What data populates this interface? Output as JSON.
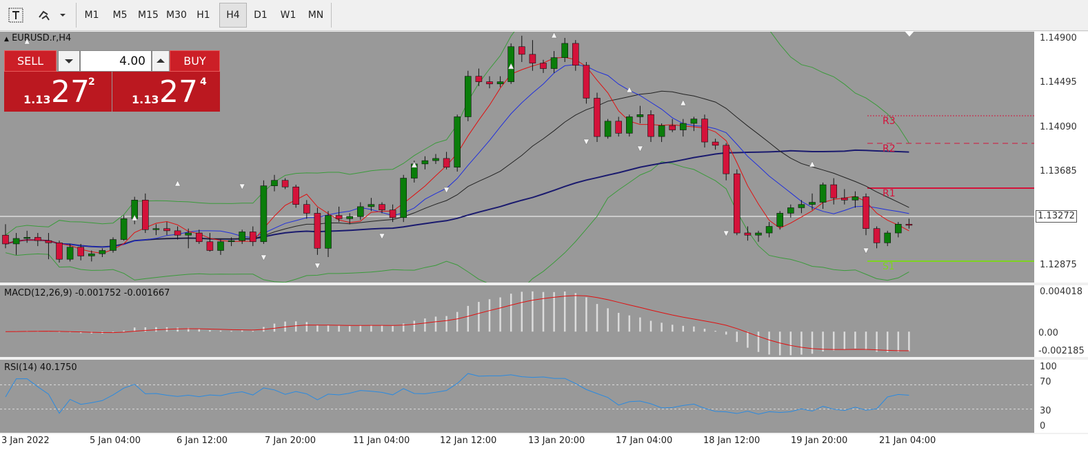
{
  "toolbar": {
    "periods": [
      {
        "label": "M1",
        "active": false
      },
      {
        "label": "M5",
        "active": false
      },
      {
        "label": "M15",
        "active": false
      },
      {
        "label": "M30",
        "active": false
      },
      {
        "label": "H1",
        "active": false
      },
      {
        "label": "H4",
        "active": true
      },
      {
        "label": "D1",
        "active": false
      },
      {
        "label": "W1",
        "active": false
      },
      {
        "label": "MN",
        "active": false
      }
    ]
  },
  "chart": {
    "symbol_label": "EURUSD.r,H4",
    "price_axis": [
      "1.14900",
      "1.14495",
      "1.14090",
      "1.13685",
      "1.13272",
      "1.12875"
    ],
    "current_price": "1.13272",
    "pivots": {
      "r3": "R3",
      "r2": "R2",
      "r1": "R1",
      "s1": "S1"
    },
    "colors": {
      "bull": "#0a7d0a",
      "bear": "#d4123a",
      "bg": "#999999"
    }
  },
  "trade_panel": {
    "sell_label": "SELL",
    "buy_label": "BUY",
    "lot": "4.00",
    "sell_price": {
      "small": "1.13",
      "big": "27",
      "sup": "2"
    },
    "buy_price": {
      "small": "1.13",
      "big": "27",
      "sup": "4"
    }
  },
  "macd": {
    "label": "MACD(12,26,9) -0.001752 -0.001667",
    "axis": [
      "0.004018",
      "0.00",
      "-0.002185"
    ]
  },
  "rsi": {
    "label": "RSI(14) 40.1750",
    "axis": [
      "100",
      "70",
      "30",
      "0"
    ]
  },
  "dates": [
    "3 Jan 2022",
    "5 Jan 04:00",
    "6 Jan 12:00",
    "7 Jan 20:00",
    "11 Jan 04:00",
    "12 Jan 12:00",
    "13 Jan 20:00",
    "17 Jan 04:00",
    "18 Jan 12:00",
    "19 Jan 20:00",
    "21 Jan 04:00"
  ],
  "chart_data": {
    "type": "candlestick",
    "symbol": "EURUSD.r",
    "timeframe": "H4",
    "candles": [
      [
        1.131,
        1.132,
        1.1298,
        1.1302
      ],
      [
        1.1302,
        1.1312,
        1.1292,
        1.1307
      ],
      [
        1.1307,
        1.1314,
        1.1303,
        1.1308
      ],
      [
        1.1308,
        1.1312,
        1.13,
        1.1305
      ],
      [
        1.1305,
        1.1312,
        1.1288,
        1.1303
      ],
      [
        1.1303,
        1.1305,
        1.1285,
        1.1288
      ],
      [
        1.1288,
        1.1302,
        1.1286,
        1.1299
      ],
      [
        1.1299,
        1.1302,
        1.1287,
        1.1291
      ],
      [
        1.1291,
        1.1296,
        1.1286,
        1.1293
      ],
      [
        1.1293,
        1.1298,
        1.129,
        1.1296
      ],
      [
        1.1296,
        1.1308,
        1.1294,
        1.1306
      ],
      [
        1.1306,
        1.1328,
        1.1305,
        1.1325
      ],
      [
        1.1325,
        1.1345,
        1.132,
        1.1342
      ],
      [
        1.1342,
        1.1348,
        1.1312,
        1.1315
      ],
      [
        1.1315,
        1.132,
        1.131,
        1.1316
      ],
      [
        1.1316,
        1.1322,
        1.131,
        1.1314
      ],
      [
        1.1314,
        1.1318,
        1.1306,
        1.131
      ],
      [
        1.131,
        1.1316,
        1.1298,
        1.1312
      ],
      [
        1.1312,
        1.1315,
        1.1302,
        1.1304
      ],
      [
        1.1304,
        1.1312,
        1.1295,
        1.1296
      ],
      [
        1.1296,
        1.1306,
        1.1292,
        1.1304
      ],
      [
        1.1304,
        1.1308,
        1.13,
        1.1305
      ],
      [
        1.1305,
        1.1315,
        1.1302,
        1.1313
      ],
      [
        1.1313,
        1.1318,
        1.13,
        1.1304
      ],
      [
        1.1304,
        1.136,
        1.1302,
        1.1355
      ],
      [
        1.1355,
        1.1365,
        1.135,
        1.136
      ],
      [
        1.136,
        1.1362,
        1.1352,
        1.1354
      ],
      [
        1.1354,
        1.1356,
        1.1335,
        1.1338
      ],
      [
        1.1338,
        1.1342,
        1.1325,
        1.133
      ],
      [
        1.133,
        1.1335,
        1.1292,
        1.1298
      ],
      [
        1.1298,
        1.1332,
        1.129,
        1.1328
      ],
      [
        1.1328,
        1.1336,
        1.1322,
        1.1325
      ],
      [
        1.1325,
        1.133,
        1.132,
        1.1327
      ],
      [
        1.1327,
        1.134,
        1.1324,
        1.1336
      ],
      [
        1.1336,
        1.1344,
        1.1332,
        1.1338
      ],
      [
        1.1338,
        1.134,
        1.133,
        1.1333
      ],
      [
        1.1333,
        1.1338,
        1.1322,
        1.1326
      ],
      [
        1.1326,
        1.1365,
        1.1322,
        1.1362
      ],
      [
        1.1362,
        1.1378,
        1.1358,
        1.1375
      ],
      [
        1.1375,
        1.1382,
        1.137,
        1.1378
      ],
      [
        1.1378,
        1.1384,
        1.1375,
        1.138
      ],
      [
        1.138,
        1.1386,
        1.137,
        1.1372
      ],
      [
        1.1372,
        1.142,
        1.1368,
        1.1418
      ],
      [
        1.1418,
        1.146,
        1.1414,
        1.1455
      ],
      [
        1.1455,
        1.1462,
        1.1446,
        1.145
      ],
      [
        1.145,
        1.1455,
        1.1444,
        1.1448
      ],
      [
        1.1448,
        1.1455,
        1.1445,
        1.145
      ],
      [
        1.145,
        1.1485,
        1.1448,
        1.1482
      ],
      [
        1.1482,
        1.1492,
        1.1468,
        1.1475
      ],
      [
        1.1475,
        1.1488,
        1.146,
        1.1467
      ],
      [
        1.1467,
        1.147,
        1.1458,
        1.1462
      ],
      [
        1.1462,
        1.1478,
        1.1458,
        1.1472
      ],
      [
        1.1472,
        1.149,
        1.1468,
        1.1485
      ],
      [
        1.1485,
        1.1488,
        1.146,
        1.1465
      ],
      [
        1.1465,
        1.1468,
        1.143,
        1.1435
      ],
      [
        1.1435,
        1.144,
        1.1395,
        1.14
      ],
      [
        1.14,
        1.1416,
        1.1398,
        1.1414
      ],
      [
        1.1414,
        1.1418,
        1.14,
        1.1403
      ],
      [
        1.1403,
        1.142,
        1.14,
        1.1418
      ],
      [
        1.1418,
        1.1428,
        1.1412,
        1.142
      ],
      [
        1.142,
        1.1424,
        1.1395,
        1.14
      ],
      [
        1.14,
        1.1412,
        1.1395,
        1.141
      ],
      [
        1.141,
        1.1416,
        1.1404,
        1.1406
      ],
      [
        1.1406,
        1.1416,
        1.14,
        1.1412
      ],
      [
        1.1412,
        1.1418,
        1.1405,
        1.1416
      ],
      [
        1.1416,
        1.142,
        1.139,
        1.1395
      ],
      [
        1.1395,
        1.1398,
        1.1388,
        1.1392
      ],
      [
        1.1392,
        1.1394,
        1.136,
        1.1366
      ],
      [
        1.1366,
        1.137,
        1.131,
        1.1312
      ],
      [
        1.1312,
        1.1318,
        1.1305,
        1.131
      ],
      [
        1.131,
        1.1314,
        1.1304,
        1.1312
      ],
      [
        1.1312,
        1.1322,
        1.1308,
        1.1318
      ],
      [
        1.1318,
        1.1332,
        1.1315,
        1.133
      ],
      [
        1.133,
        1.1338,
        1.1326,
        1.1335
      ],
      [
        1.1335,
        1.1342,
        1.133,
        1.1338
      ],
      [
        1.1338,
        1.1348,
        1.1333,
        1.134
      ],
      [
        1.134,
        1.1358,
        1.1334,
        1.1356
      ],
      [
        1.1356,
        1.1362,
        1.1338,
        1.1344
      ],
      [
        1.1344,
        1.1352,
        1.1338,
        1.1342
      ],
      [
        1.1342,
        1.135,
        1.1335,
        1.1345
      ],
      [
        1.1345,
        1.1348,
        1.131,
        1.1316
      ],
      [
        1.1316,
        1.1318,
        1.1298,
        1.1303
      ],
      [
        1.1303,
        1.1314,
        1.13,
        1.1312
      ],
      [
        1.1312,
        1.1322,
        1.1308,
        1.132
      ],
      [
        1.132,
        1.1325,
        1.1316,
        1.1319
      ]
    ],
    "candle_format": [
      "open",
      "high",
      "low",
      "close"
    ],
    "y_axis": {
      "ticks": [
        1.149,
        1.14495,
        1.1409,
        1.13685,
        1.13272,
        1.12875
      ]
    },
    "x_axis": {
      "ticks": [
        "3 Jan 2022",
        "5 Jan 04:00",
        "6 Jan 12:00",
        "7 Jan 20:00",
        "11 Jan 04:00",
        "12 Jan 12:00",
        "13 Jan 20:00",
        "17 Jan 04:00",
        "18 Jan 12:00",
        "19 Jan 20:00",
        "21 Jan 04:00"
      ]
    },
    "current_price": 1.13272,
    "macd": {
      "params": "12,26,9",
      "main": -0.001752,
      "signal": -0.001667,
      "ylim": [
        -0.002185,
        0.004018
      ]
    },
    "rsi": {
      "period": 14,
      "value": 40.175,
      "levels": [
        70,
        30
      ]
    }
  }
}
